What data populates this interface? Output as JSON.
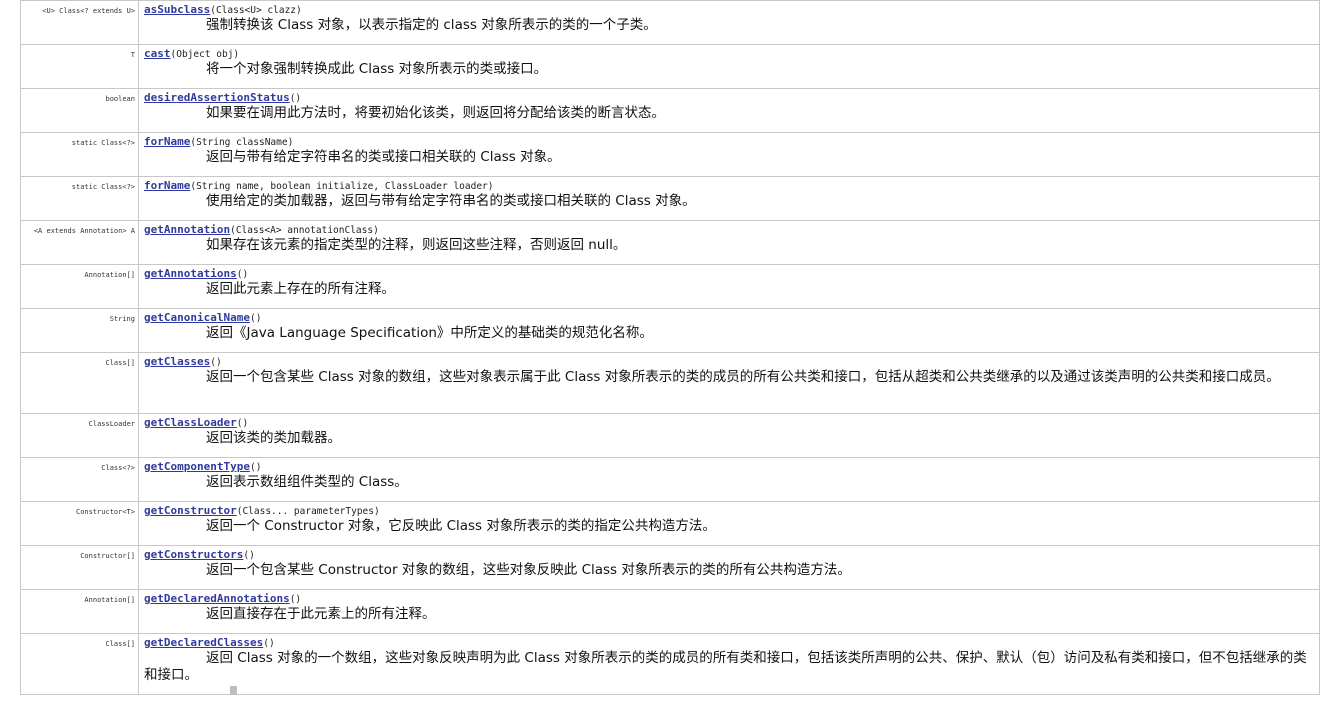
{
  "rows": [
    {
      "type": "<U> Class<? extends U>",
      "method": "asSubclass",
      "params": "(Class<U> clazz)",
      "desc": "强制转换该 Class 对象，以表示指定的 class 对象所表示的类的一个子类。"
    },
    {
      "type": "T",
      "method": "cast",
      "params": "(Object obj)",
      "desc": "将一个对象强制转换成此 Class 对象所表示的类或接口。"
    },
    {
      "type": "boolean",
      "method": "desiredAssertionStatus",
      "params": "()",
      "desc": "如果要在调用此方法时，将要初始化该类，则返回将分配给该类的断言状态。"
    },
    {
      "type": "static Class<?>",
      "method": "forName",
      "params": "(String className)",
      "desc": "返回与带有给定字符串名的类或接口相关联的 Class 对象。"
    },
    {
      "type": "static Class<?>",
      "method": "forName",
      "params": "(String name, boolean initialize, ClassLoader loader)",
      "desc": "使用给定的类加载器，返回与带有给定字符串名的类或接口相关联的 Class 对象。"
    },
    {
      "type": "<A extends Annotation> A",
      "method": "getAnnotation",
      "params": "(Class<A> annotationClass)",
      "desc": "如果存在该元素的指定类型的注释，则返回这些注释，否则返回 null。"
    },
    {
      "type": "Annotation[]",
      "method": "getAnnotations",
      "params": "()",
      "desc": "返回此元素上存在的所有注释。"
    },
    {
      "type": "String",
      "method": "getCanonicalName",
      "params": "()",
      "desc": "返回《Java Language Specification》中所定义的基础类的规范化名称。"
    },
    {
      "type": "Class[]",
      "method": "getClasses",
      "params": "()",
      "desc": "返回一个包含某些 Class 对象的数组，这些对象表示属于此 Class 对象所表示的类的成员的所有公共类和接口，包括从超类和公共类继承的以及通过该类声明的公共类和接口成员。"
    },
    {
      "type": "ClassLoader",
      "method": "getClassLoader",
      "params": "()",
      "desc": "返回该类的类加载器。"
    },
    {
      "type": "Class<?>",
      "method": "getComponentType",
      "params": "()",
      "desc": "返回表示数组组件类型的 Class。"
    },
    {
      "type": "Constructor<T>",
      "method": "getConstructor",
      "params": "(Class... parameterTypes)",
      "desc": "返回一个 Constructor 对象，它反映此 Class 对象所表示的类的指定公共构造方法。"
    },
    {
      "type": "Constructor[]",
      "method": "getConstructors",
      "params": "()",
      "desc": "返回一个包含某些 Constructor 对象的数组，这些对象反映此 Class 对象所表示的类的所有公共构造方法。"
    },
    {
      "type": "Annotation[]",
      "method": "getDeclaredAnnotations",
      "params": "()",
      "desc": "返回直接存在于此元素上的所有注释。"
    },
    {
      "type": "Class[]",
      "method": "getDeclaredClasses",
      "params": "()",
      "desc": "返回 Class 对象的一个数组，这些对象反映声明为此 Class 对象所表示的类的成员的所有类和接口，包括该类所声明的公共、保护、默认（包）访问及私有类和接口，但不包括继承的类和接口。"
    }
  ]
}
